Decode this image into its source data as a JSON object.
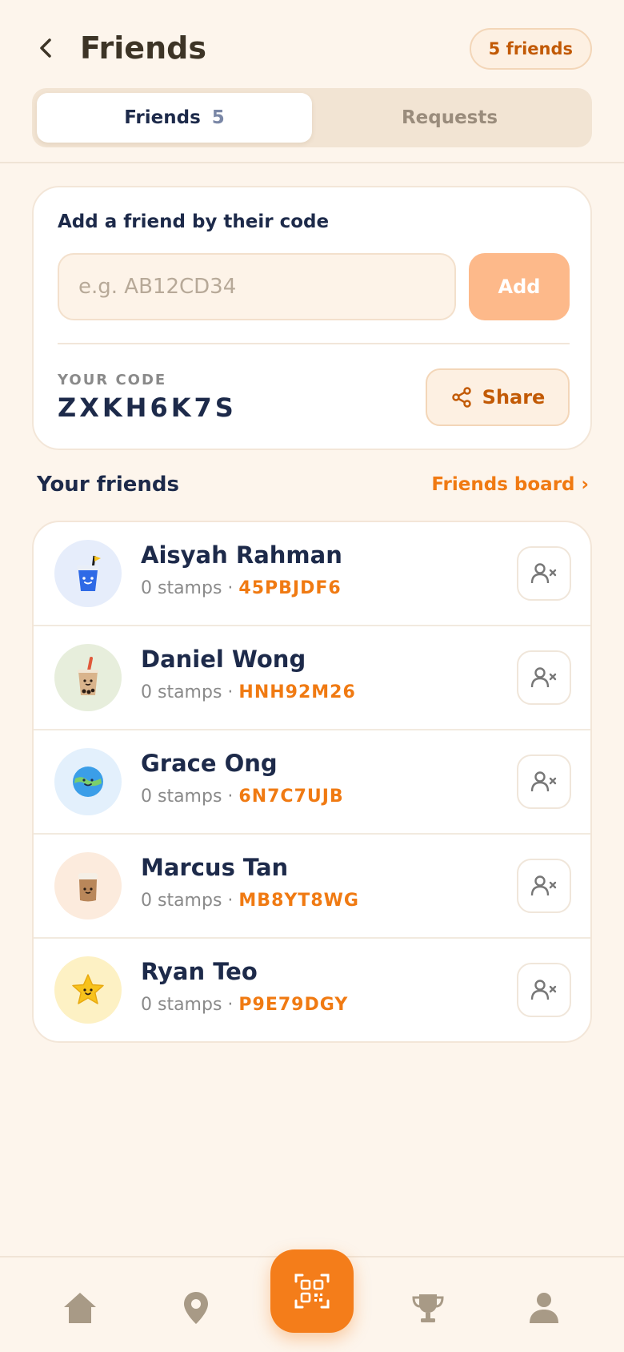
{
  "header": {
    "title": "Friends",
    "count_pill": "5 friends",
    "back_icon": "chevron-left-icon"
  },
  "tabs": [
    {
      "label": "Friends",
      "count": "5",
      "active": true
    },
    {
      "label": "Requests",
      "count": "",
      "active": false
    }
  ],
  "add_friend": {
    "title": "Add a friend by their code",
    "placeholder": "e.g. AB12CD34",
    "value": "",
    "add_label": "Add",
    "your_code_label": "YOUR CODE",
    "your_code": "ZXKH6K7S",
    "share_label": "Share"
  },
  "friends_section": {
    "title": "Your friends",
    "board_link": "Friends board ›"
  },
  "friends": [
    {
      "name": "Aisyah Rahman",
      "stamps": "0 stamps · ",
      "code": "45PBJDF6",
      "avatar": "blue-cup-flag-icon",
      "avatar_bg": "#e6edfb"
    },
    {
      "name": "Daniel Wong",
      "stamps": "0 stamps · ",
      "code": "HNH92M26",
      "avatar": "bubble-tea-icon",
      "avatar_bg": "#e7eedc"
    },
    {
      "name": "Grace Ong",
      "stamps": "0 stamps · ",
      "code": "6N7C7UJB",
      "avatar": "smiling-globe-icon",
      "avatar_bg": "#e3f0fc"
    },
    {
      "name": "Marcus Tan",
      "stamps": "0 stamps · ",
      "code": "MB8YT8WG",
      "avatar": "coffee-cup-icon",
      "avatar_bg": "#fcebdd"
    },
    {
      "name": "Ryan Teo",
      "stamps": "0 stamps · ",
      "code": "P9E79DGY",
      "avatar": "smiling-star-icon",
      "avatar_bg": "#fdf1c4"
    }
  ],
  "bottom_nav": [
    "home-icon",
    "map-pin-icon",
    "qr-scan-icon",
    "trophy-icon",
    "profile-icon"
  ],
  "colors": {
    "accent": "#f07a12",
    "background": "#fdf5ec",
    "text": "#1d2a4a"
  }
}
